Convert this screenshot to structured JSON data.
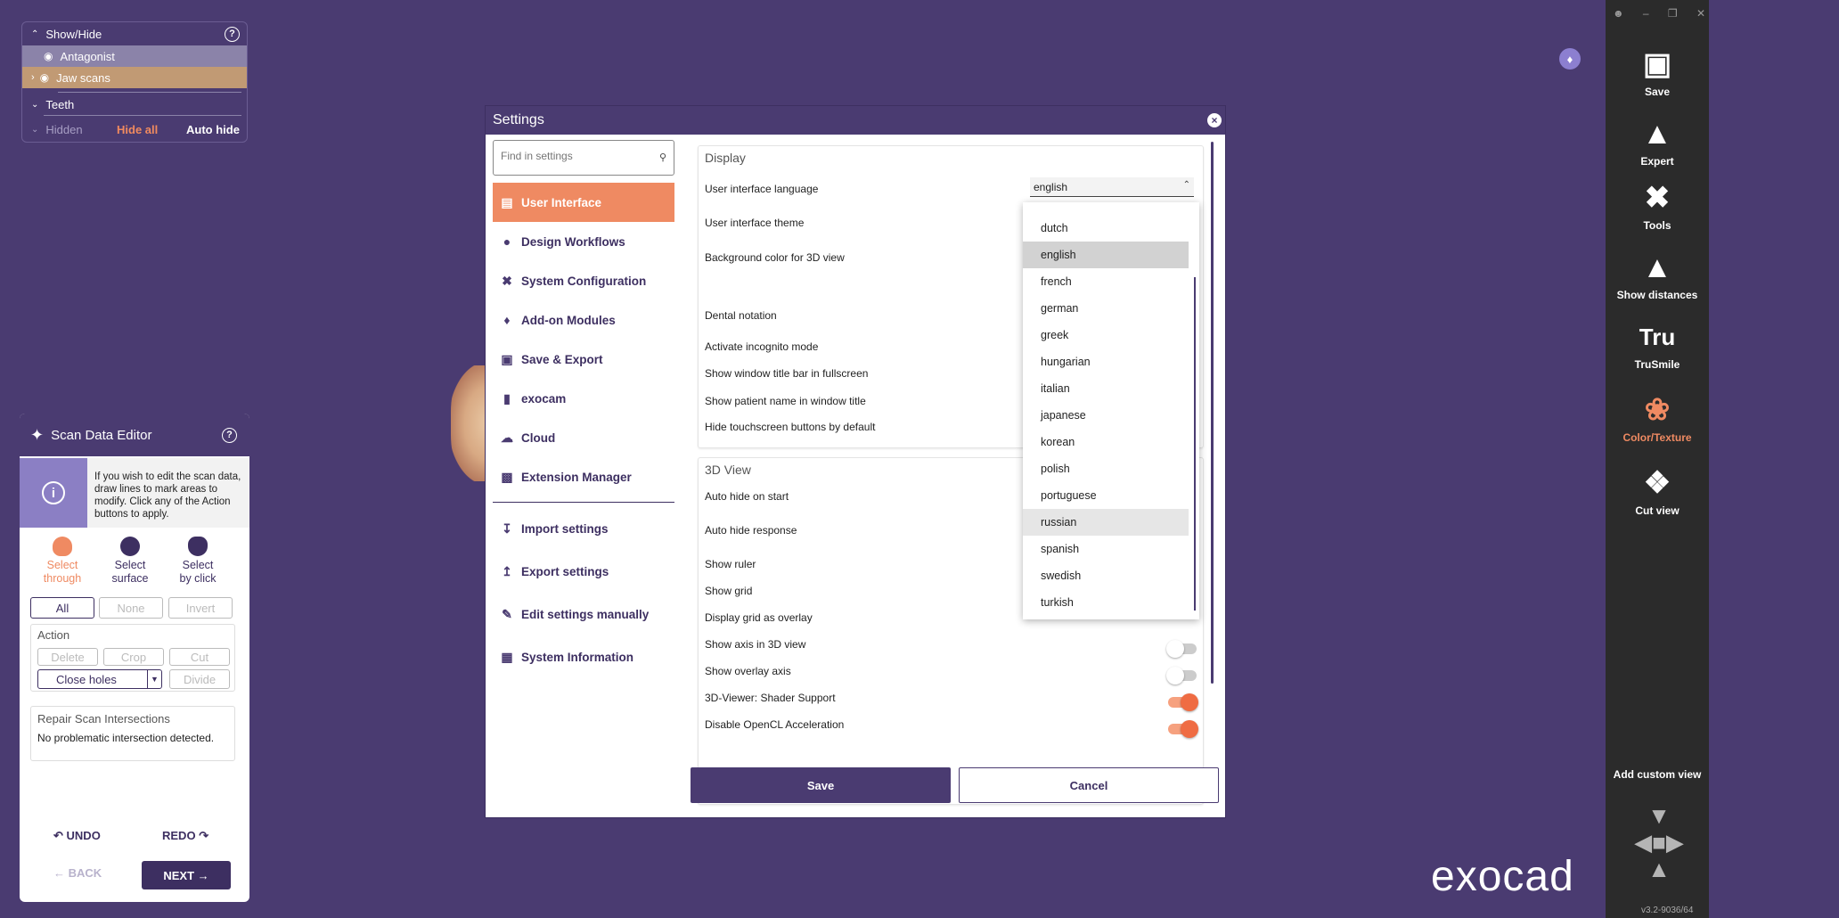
{
  "showhide": {
    "title": "Show/Hide",
    "antagonist": "Antagonist",
    "jaw_scans": "Jaw scans",
    "teeth": "Teeth",
    "hidden": "Hidden",
    "hide_all": "Hide all",
    "auto_hide": "Auto hide"
  },
  "scan_editor": {
    "title": "Scan Data Editor",
    "info": "If you wish to edit the scan data, draw lines to mark areas to modify. Click any of the Action buttons to apply.",
    "select_through": [
      "Select",
      "through"
    ],
    "select_surface": [
      "Select",
      "surface"
    ],
    "select_click": [
      "Select",
      "by click"
    ],
    "all": "All",
    "none": "None",
    "invert": "Invert",
    "action": "Action",
    "delete": "Delete",
    "crop": "Crop",
    "cut": "Cut",
    "close_holes": "Close holes",
    "divide": "Divide",
    "repair_title": "Repair Scan Intersections",
    "repair_text": "No problematic intersection detected.",
    "undo": "UNDO",
    "redo": "REDO",
    "back": "BACK",
    "next": "NEXT"
  },
  "settings": {
    "title": "Settings",
    "search_placeholder": "Find in settings",
    "nav": [
      {
        "label": "User Interface",
        "icon": "user-interface-icon"
      },
      {
        "label": "Design Workflows",
        "icon": "workflow-icon"
      },
      {
        "label": "System Configuration",
        "icon": "tools-icon"
      },
      {
        "label": "Add-on Modules",
        "icon": "puzzle-icon"
      },
      {
        "label": "Save & Export",
        "icon": "save-icon"
      },
      {
        "label": "exocam",
        "icon": "exocam-icon"
      },
      {
        "label": "Cloud",
        "icon": "cloud-icon"
      },
      {
        "label": "Extension Manager",
        "icon": "extension-icon"
      },
      {
        "label": "Import settings",
        "icon": "import-icon"
      },
      {
        "label": "Export settings",
        "icon": "export-icon"
      },
      {
        "label": "Edit settings manually",
        "icon": "pencil-icon"
      },
      {
        "label": "System Information",
        "icon": "info-icon"
      }
    ],
    "display_section": "Display",
    "display_items": [
      "User interface language",
      "User interface theme",
      "Background color for 3D view",
      "Dental notation",
      "Activate incognito mode",
      "Show window title bar in fullscreen",
      "Show patient name in window title",
      "Hide touchscreen buttons by default"
    ],
    "language_value": "english",
    "languages": [
      "dutch",
      "english",
      "french",
      "german",
      "greek",
      "hungarian",
      "italian",
      "japanese",
      "korean",
      "polish",
      "portuguese",
      "russian",
      "spanish",
      "swedish",
      "turkish"
    ],
    "view3d_section": "3D View",
    "view3d_items": [
      {
        "label": "Auto hide on start",
        "toggle": null
      },
      {
        "label": "Auto hide response",
        "toggle": null
      },
      {
        "label": "Show ruler",
        "toggle": null
      },
      {
        "label": "Show grid",
        "toggle": null
      },
      {
        "label": "Display grid as overlay",
        "toggle": null
      },
      {
        "label": "Show axis in 3D view",
        "toggle": false
      },
      {
        "label": "Show overlay axis",
        "toggle": false
      },
      {
        "label": "3D-Viewer: Shader Support",
        "toggle": true
      },
      {
        "label": "Disable OpenCL Acceleration",
        "toggle": true
      }
    ],
    "save": "Save",
    "cancel": "Cancel"
  },
  "toolbar": [
    {
      "label": "Save",
      "icon": "floppy-icon"
    },
    {
      "label": "Expert",
      "icon": "graduation-cap-icon"
    },
    {
      "label": "Tools",
      "icon": "tools-icon"
    },
    {
      "label": "Show distances",
      "icon": "distances-icon"
    },
    {
      "label": "TruSmile",
      "icon": "trusmile-icon"
    },
    {
      "label": "Color/Texture",
      "icon": "palette-icon"
    },
    {
      "label": "Cut view",
      "icon": "cut-view-icon"
    }
  ],
  "add_custom_view": "Add custom view",
  "brand": "exocad",
  "version": "v3.2-9036/64",
  "colors": {
    "purple": "#4a3b71",
    "orange": "#ef8a62",
    "dark": "#2b2b2b"
  }
}
